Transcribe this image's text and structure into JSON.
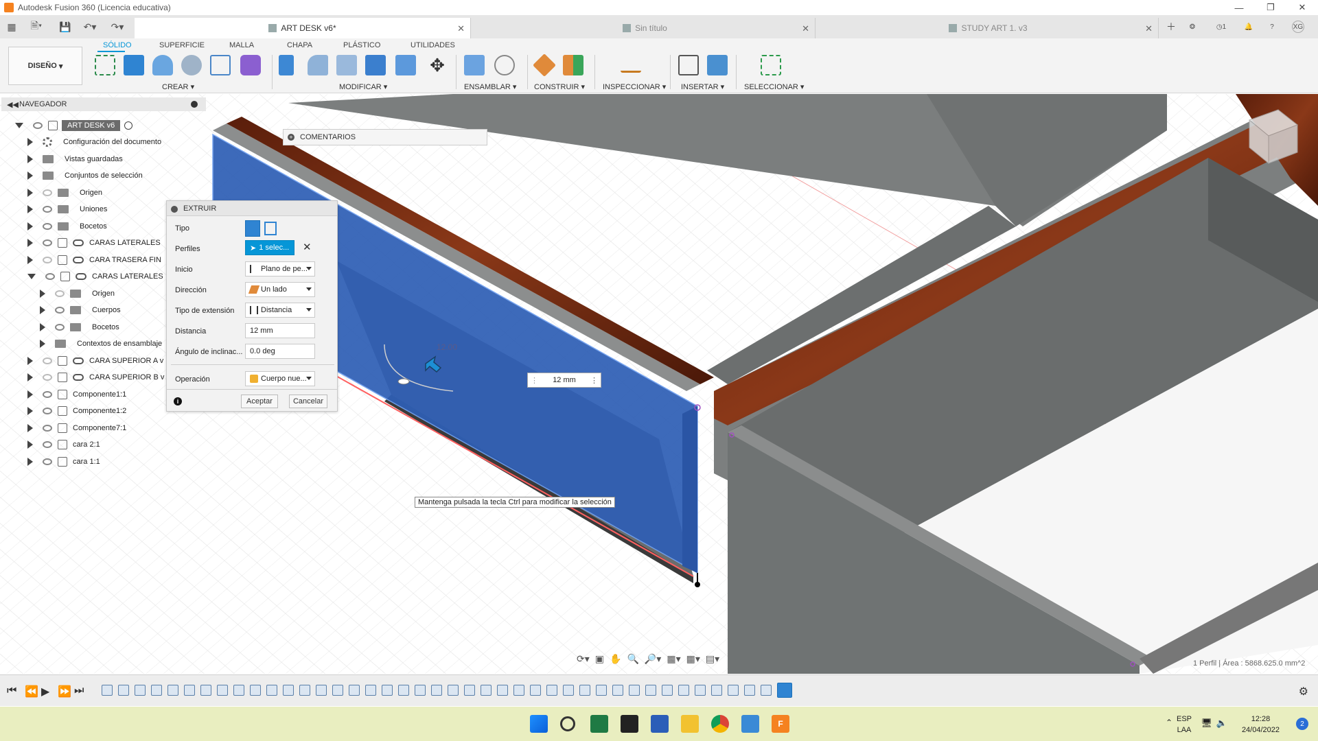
{
  "window": {
    "title": "Autodesk Fusion 360 (Licencia educativa)"
  },
  "tabs": [
    {
      "label": "ART DESK v6*",
      "active": true
    },
    {
      "label": "Sin título",
      "active": false
    },
    {
      "label": "STUDY ART 1. v3",
      "active": false
    }
  ],
  "header_right": {
    "jobs_count": "1",
    "user_initials": "XG"
  },
  "toolbar": {
    "workspace": "DISEÑO",
    "tabs": [
      "SÓLIDO",
      "SUPERFICIE",
      "MALLA",
      "CHAPA",
      "PLÁSTICO",
      "UTILIDADES"
    ],
    "groups": [
      "CREAR",
      "MODIFICAR",
      "ENSAMBLAR",
      "CONSTRUIR",
      "INSPECCIONAR",
      "INSERTAR",
      "SELECCIONAR"
    ]
  },
  "navigator": {
    "title": "NAVEGADOR",
    "root": "ART DESK v6",
    "items": [
      {
        "label": "Configuración del documento",
        "icon": "gear-icon",
        "indent": 1
      },
      {
        "label": "Vistas guardadas",
        "icon": "folder-icon",
        "indent": 1
      },
      {
        "label": "Conjuntos de selección",
        "icon": "folder-icon",
        "indent": 1
      },
      {
        "label": "Origen",
        "icon": "folder-icon",
        "indent": 1,
        "eye": "off"
      },
      {
        "label": "Uniones",
        "icon": "folder-icon",
        "indent": 1,
        "eye": "on"
      },
      {
        "label": "Bocetos",
        "icon": "folder-icon",
        "indent": 1,
        "eye": "on"
      },
      {
        "label": "CARAS LATERALES",
        "icon": "link-icon",
        "indent": 1,
        "eye": "on"
      },
      {
        "label": "CARA TRASERA FIN",
        "icon": "link-icon",
        "indent": 1,
        "eye": "off"
      },
      {
        "label": "CARAS LATERALES",
        "icon": "link-icon",
        "indent": 1,
        "eye": "on",
        "open": true
      },
      {
        "label": "Origen",
        "icon": "folder-icon",
        "indent": 2,
        "eye": "off"
      },
      {
        "label": "Cuerpos",
        "icon": "folder-icon",
        "indent": 2,
        "eye": "on"
      },
      {
        "label": "Bocetos",
        "icon": "folder-icon",
        "indent": 2,
        "eye": "on"
      },
      {
        "label": "Contextos de ensamblaje",
        "icon": "folder-icon",
        "indent": 2
      },
      {
        "label": "CARA SUPERIOR A v",
        "icon": "link-icon",
        "indent": 1,
        "eye": "off"
      },
      {
        "label": "CARA SUPERIOR B v",
        "icon": "link-icon",
        "indent": 1,
        "eye": "off"
      },
      {
        "label": "Componente1:1",
        "icon": "component-icon",
        "indent": 1,
        "eye": "on"
      },
      {
        "label": "Componente1:2",
        "icon": "component-icon",
        "indent": 1,
        "eye": "on"
      },
      {
        "label": "Componente7:1",
        "icon": "component-icon",
        "indent": 1,
        "eye": "on"
      },
      {
        "label": "cara 2:1",
        "icon": "body-icon",
        "indent": 1,
        "eye": "on"
      },
      {
        "label": "cara 1:1",
        "icon": "body-icon",
        "indent": 1,
        "eye": "on"
      }
    ]
  },
  "comments_panel": {
    "title": "COMENTARIOS"
  },
  "extrude": {
    "title": "EXTRUIR",
    "rows": {
      "tipo": "Tipo",
      "perfiles": "Perfiles",
      "perfiles_value": "1 selec...",
      "inicio": "Inicio",
      "inicio_value": "Plano de pe...",
      "direccion": "Dirección",
      "direccion_value": "Un lado",
      "tipo_ext": "Tipo de extensión",
      "tipo_ext_value": "Distancia",
      "distancia": "Distancia",
      "distancia_value": "12 mm",
      "angulo": "Ángulo de inclinac...",
      "angulo_value": "0.0 deg",
      "operacion": "Operación",
      "operacion_value": "Cuerpo nue..."
    },
    "ok": "Aceptar",
    "cancel": "Cancelar"
  },
  "viewport": {
    "dimension_label": "12.00",
    "dimension_input": "12 mm",
    "tooltip": "Mantenga pulsada la tecla Ctrl para modificar la selección",
    "status": "1 Perfil | Área : 5868.625.0 mm^2"
  },
  "taskbar": {
    "lang": "ESP",
    "lang2": "LAA",
    "time": "12:28",
    "date": "24/04/2022",
    "notifications": "2"
  },
  "colors": {
    "accent": "#0696d7",
    "selection": "#2d5fb8",
    "wood": "#7a2e12",
    "wall": "#676b6b"
  }
}
